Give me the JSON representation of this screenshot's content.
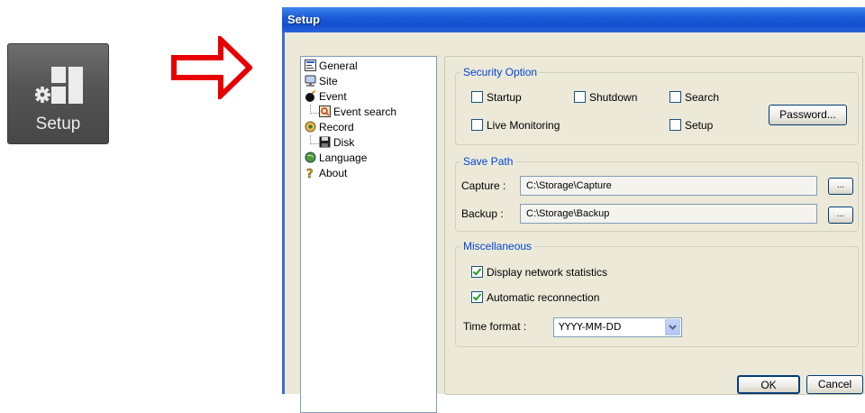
{
  "launcher": {
    "label": "Setup"
  },
  "window": {
    "title": "Setup"
  },
  "tree": [
    {
      "label": "General",
      "icon": "general-icon"
    },
    {
      "label": "Site",
      "icon": "site-icon"
    },
    {
      "label": "Event",
      "icon": "event-icon"
    },
    {
      "label": "Event search",
      "icon": "event-search-icon"
    },
    {
      "label": "Record",
      "icon": "record-icon"
    },
    {
      "label": "Disk",
      "icon": "disk-icon"
    },
    {
      "label": "Language",
      "icon": "language-icon"
    },
    {
      "label": "About",
      "icon": "about-icon"
    }
  ],
  "security": {
    "legend": "Security Option",
    "startup": "Startup",
    "shutdown": "Shutdown",
    "search": "Search",
    "live_monitoring": "Live Monitoring",
    "setup": "Setup",
    "password_button": "Password..."
  },
  "save_path": {
    "legend": "Save Path",
    "capture_label": "Capture :",
    "capture_value": "C:\\Storage\\Capture",
    "backup_label": "Backup :",
    "backup_value": "C:\\Storage\\Backup",
    "browse_label": "..."
  },
  "misc": {
    "legend": "Miscellaneous",
    "display_network_statistics": "Display network statistics",
    "automatic_reconnection": "Automatic reconnection",
    "time_format_label": "Time format :",
    "time_format_value": "YYYY-MM-DD"
  },
  "buttons": {
    "ok": "OK",
    "cancel": "Cancel"
  },
  "colors": {
    "titlebar": "#1250cf",
    "legend": "#0046d5",
    "arrow": "#e80000"
  }
}
